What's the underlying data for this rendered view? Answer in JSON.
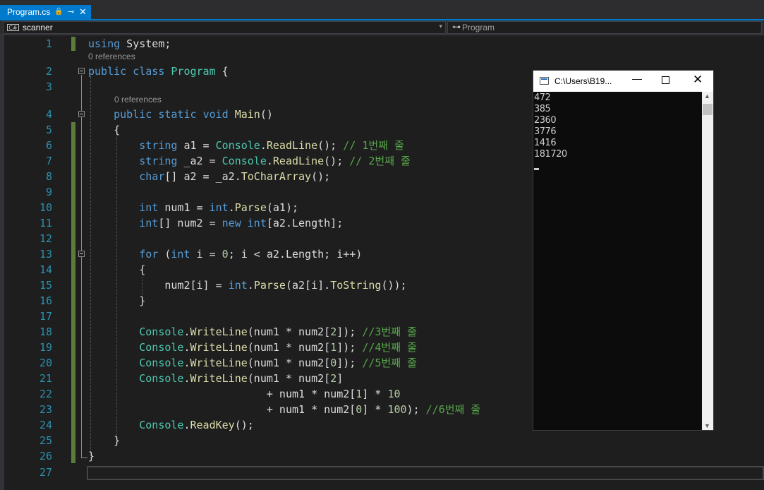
{
  "tab": {
    "filename": "Program.cs",
    "pin_glyph": "🔒",
    "pin2_glyph": "⊸",
    "close_glyph": "✕"
  },
  "navbar": {
    "project": "scanner",
    "project_icon_text": "C#",
    "member": "Program",
    "dropdown_glyph": "▾",
    "member_icon": "⊶"
  },
  "editor": {
    "lens_refs": "0 references",
    "line_numbers": [
      "1",
      "2",
      "3",
      "4",
      "5",
      "6",
      "7",
      "8",
      "9",
      "10",
      "11",
      "12",
      "13",
      "14",
      "15",
      "16",
      "17",
      "18",
      "19",
      "20",
      "21",
      "22",
      "23",
      "24",
      "25",
      "26",
      "27"
    ]
  },
  "console": {
    "title": "C:\\Users\\B19...",
    "minimize_glyph": "—",
    "close_glyph": "✕",
    "output": [
      "472",
      "385",
      "2360",
      "3776",
      "1416",
      "181720"
    ],
    "scroll_up": "▲",
    "scroll_down": "▼"
  },
  "colors": {
    "accent": "#007acc",
    "keyword": "#569cd6",
    "type": "#4ec9b0",
    "comment": "#57a64a",
    "number": "#b5cea8",
    "method": "#dcdcaa"
  },
  "icons": [
    "lock-icon",
    "pin-icon",
    "close-icon",
    "csharp-project-icon",
    "dropdown-icon",
    "class-icon",
    "console-app-icon",
    "minimize-icon",
    "maximize-icon"
  ]
}
